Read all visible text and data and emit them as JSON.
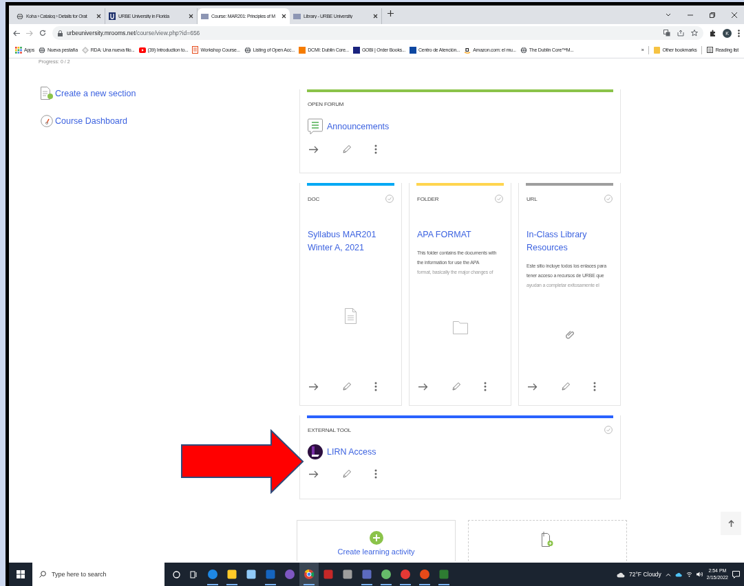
{
  "browser": {
    "tabs": [
      {
        "title": "Koha › Catalog › Details for Orat",
        "kind": "globe",
        "selected": false
      },
      {
        "title": "URBE University in Florida",
        "kind": "urbe-u",
        "selected": false
      },
      {
        "title": "Course: MAR201: Principles of M",
        "kind": "urbe-logo",
        "selected": true
      },
      {
        "title": "Library - URBE University",
        "kind": "urbe-logo",
        "selected": false
      }
    ],
    "url": {
      "host": "urbeuniversity.mrooms.net",
      "path": "/course/view.php?id=656"
    },
    "profile_initial": "K",
    "bookmarks": [
      {
        "label": "Apps",
        "kind": "apps"
      },
      {
        "label": "Nueva pestaña",
        "kind": "globe"
      },
      {
        "label": "RDA: Una nueva filo...",
        "kind": "diamond"
      },
      {
        "label": "(39) Introduction to...",
        "kind": "video"
      },
      {
        "label": "Workshop Course...",
        "kind": "page"
      },
      {
        "label": "Listing of Open Acc...",
        "kind": "globe"
      },
      {
        "label": "DCMI: Dublin Core...",
        "kind": "square",
        "color": "#f57c00"
      },
      {
        "label": "GOBI | Order Books...",
        "kind": "square",
        "color": "#1a237e"
      },
      {
        "label": "Centro de Atención...",
        "kind": "square",
        "color": "#0d47a1"
      },
      {
        "label": "Amazon.com: el mu...",
        "kind": "amazon"
      },
      {
        "label": "The Dublin Core™M...",
        "kind": "globe"
      }
    ],
    "overflow": "»",
    "other_bookmarks": "Other bookmarks",
    "reading_list": "Reading list"
  },
  "page": {
    "progress": "Progress: 0 / 2",
    "side_links": [
      {
        "label": "Create a new section",
        "kind": "new-section"
      },
      {
        "label": "Course Dashboard",
        "kind": "dashboard"
      }
    ],
    "activities": [
      {
        "type": "OPEN FORUM",
        "title": "Announcements",
        "kind": "forum",
        "color": "#8bc34a",
        "completion": false
      },
      {
        "type": "DOC",
        "title": "Syllabus MAR201 Winter A, 2021",
        "kind": "doc",
        "color": "#03a9f4",
        "completion": true
      },
      {
        "type": "FOLDER",
        "title": "APA FORMAT",
        "kind": "folder",
        "color": "#ffd54f",
        "completion": true,
        "description": "This folder contains the documents with the information for use the APA",
        "description_faded": "format, basically the major changes of"
      },
      {
        "type": "URL",
        "title": "In-Class Library Resources",
        "kind": "url",
        "color": "#9e9e9e",
        "completion": true,
        "description": "Este sitio incluye todos los enlaces para tener acceso a recursos de URBE que",
        "description_faded": "ayudan a completar exitosamente el"
      },
      {
        "type": "EXTERNAL TOOL",
        "title": "LIRN Access",
        "kind": "lti",
        "color": "#2962ff",
        "completion": true
      }
    ],
    "create_activity": "Create learning activity"
  },
  "taskbar": {
    "search_placeholder": "Type here to search",
    "apps": [
      {
        "kind": "edge",
        "open": true,
        "selected": false
      },
      {
        "kind": "explorer",
        "open": true,
        "selected": false
      },
      {
        "kind": "store",
        "open": false,
        "selected": false
      },
      {
        "kind": "outlook",
        "open": true,
        "selected": false
      },
      {
        "kind": "purple",
        "open": false,
        "selected": false
      },
      {
        "kind": "chrome",
        "open": true,
        "selected": true
      },
      {
        "kind": "cards",
        "open": false,
        "selected": false
      },
      {
        "kind": "calculator",
        "open": false,
        "selected": false
      },
      {
        "kind": "teams",
        "open": true,
        "selected": false
      },
      {
        "kind": "greenball",
        "open": true,
        "selected": false
      },
      {
        "kind": "redbadge",
        "open": true,
        "selected": false
      },
      {
        "kind": "powerpoint",
        "open": true,
        "selected": false
      },
      {
        "kind": "excel",
        "open": true,
        "selected": false
      }
    ],
    "weather": "72°F Cloudy",
    "time": "2:54 PM",
    "date": "2/15/2022"
  }
}
